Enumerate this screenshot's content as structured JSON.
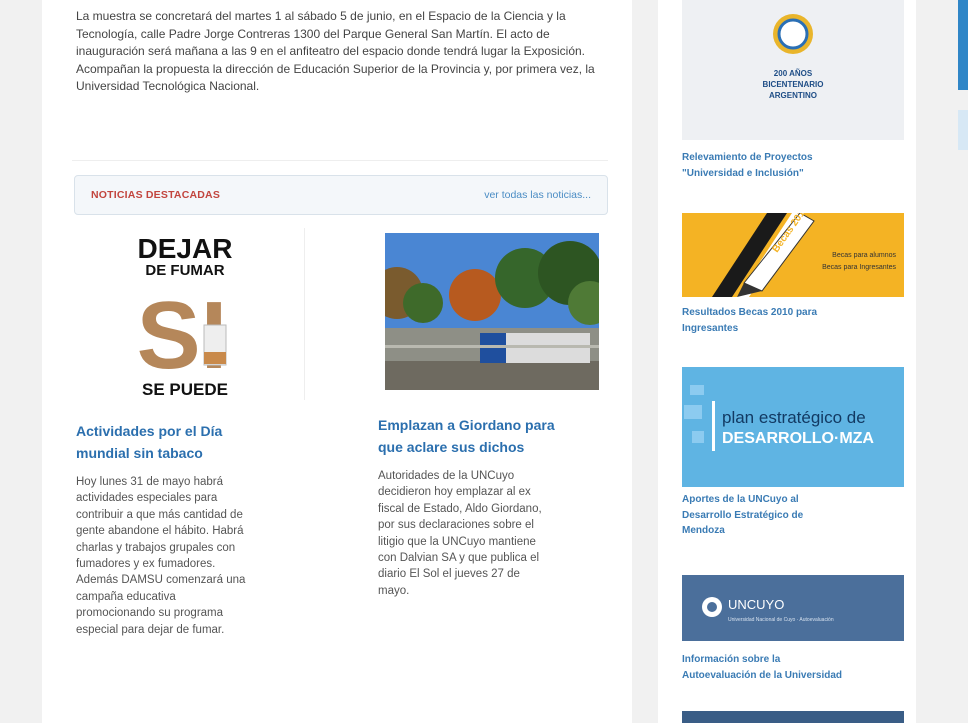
{
  "intro": "La muestra se concretará del martes 1 al sábado 5 de junio, en el Espacio de la Ciencia y la Tecnología, calle Padre Jorge Contreras 1300 del Parque General San Martín. El acto de inauguración será mañana a las 9 en el anfiteatro del espacio donde tendrá lugar la Exposición. Acompañan la propuesta la dirección de Educación Superior de la Provincia y, por primera vez, la Universidad Tecnológica Nacional.",
  "noticias": {
    "header": "NOTICIAS DESTACADAS",
    "link": "ver todas las noticias..."
  },
  "articles": [
    {
      "image_text": {
        "l1": "DEJAR",
        "l2": "DE FUMAR",
        "l3": "SI",
        "l4": "SE PUEDE"
      },
      "title_l1": "Actividades por el Día",
      "title_l2": "mundial sin tabaco",
      "body": [
        "Hoy lunes 31 de mayo habrá",
        "actividades especiales para",
        "contribuir a que más cantidad de",
        "gente abandone el hábito. Habrá",
        "charlas y trabajos grupales con",
        "fumadores y ex fumadores.",
        "Además DAMSU comenzará una",
        "campaña educativa",
        "promocionando su programa",
        "especial para dejar de fumar."
      ]
    },
    {
      "title_l1": "Emplazan a Giordano para",
      "title_l2": "que aclare sus dichos",
      "body": [
        "Autoridades de la UNCuyo",
        "decidieron hoy emplazar al ex",
        "fiscal de Estado, Aldo Giordano,",
        "por sus declaraciones sobre el",
        "litigio que la UNCuyo mantiene",
        "con Dalvian SA y que publica el",
        "diario El Sol el jueves 27 de",
        "mayo."
      ]
    }
  ],
  "sidebar": {
    "bicentenario": {
      "line1": "200 AÑOS",
      "line2": "BICENTENARIO",
      "line3": "ARGENTINO"
    },
    "caption1": [
      "Relevamiento de Proyectos",
      "\"Universidad e Inclusión\""
    ],
    "becas": {
      "tag": "Becas 2010",
      "line1": "Becas para alumnos",
      "line2": "Becas para Ingresantes"
    },
    "caption2": [
      "Resultados Becas 2010 para",
      "Ingresantes"
    ],
    "plan": {
      "line1": "plan estratégico de",
      "line2": "DESARROLLO·MZA"
    },
    "caption3": [
      "Aportes de la UNCuyo al",
      "Desarrollo Estratégico de",
      "Mendoza"
    ],
    "uncuyo": {
      "name": "UNCUYO",
      "sub": "Universidad Nacional de Cuyo · Autoevaluación"
    },
    "caption4": [
      "Información sobre la",
      "Autoevaluación de la Universidad"
    ]
  },
  "colors": {
    "link": "#2b6fae",
    "accent_red": "#c2453e",
    "becas_yellow": "#f4b324",
    "plan_blue": "#5fb4e3",
    "uncuyo_blue": "#4b6f9b"
  }
}
